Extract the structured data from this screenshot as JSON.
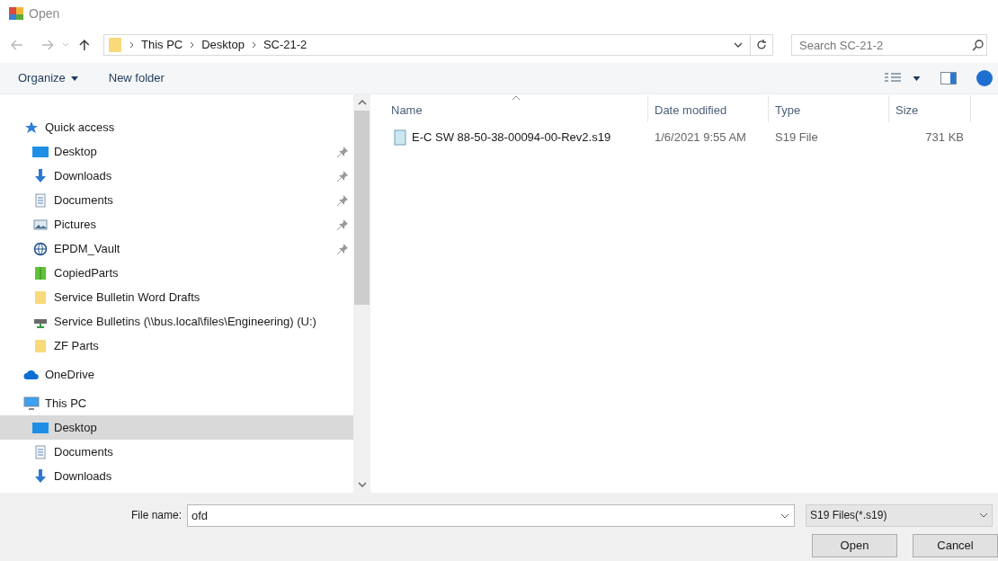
{
  "window": {
    "title": "Open"
  },
  "address": {
    "path": [
      "This PC",
      "Desktop",
      "SC-21-2"
    ]
  },
  "search": {
    "placeholder": "Search SC-21-2"
  },
  "toolbar": {
    "organize": "Organize",
    "new_folder": "New folder"
  },
  "sidebar": {
    "items": [
      {
        "kind": "quick",
        "label": "Quick access",
        "section": true,
        "pinned": false,
        "selected": false
      },
      {
        "kind": "desktop",
        "label": "Desktop",
        "section": false,
        "pinned": true,
        "selected": false
      },
      {
        "kind": "downloads",
        "label": "Downloads",
        "section": false,
        "pinned": true,
        "selected": false
      },
      {
        "kind": "documents",
        "label": "Documents",
        "section": false,
        "pinned": true,
        "selected": false
      },
      {
        "kind": "pictures",
        "label": "Pictures",
        "section": false,
        "pinned": true,
        "selected": false
      },
      {
        "kind": "vault",
        "label": "EPDM_Vault",
        "section": false,
        "pinned": true,
        "selected": false
      },
      {
        "kind": "library",
        "label": "CopiedParts",
        "section": false,
        "pinned": false,
        "selected": false
      },
      {
        "kind": "folder",
        "label": "Service Bulletin Word Drafts",
        "section": false,
        "pinned": false,
        "selected": false
      },
      {
        "kind": "drive",
        "label": "Service Bulletins (\\\\bus.local\\files\\Engineering) (U:)",
        "section": false,
        "pinned": false,
        "selected": false
      },
      {
        "kind": "folder",
        "label": "ZF Parts",
        "section": false,
        "pinned": false,
        "selected": false
      },
      {
        "kind": "cloud",
        "label": "OneDrive",
        "section": true,
        "pinned": false,
        "selected": false
      },
      {
        "kind": "pc",
        "label": "This PC",
        "section": true,
        "pinned": false,
        "selected": false
      },
      {
        "kind": "desktop",
        "label": "Desktop",
        "section": false,
        "pinned": false,
        "selected": true
      },
      {
        "kind": "documents",
        "label": "Documents",
        "section": false,
        "pinned": false,
        "selected": false
      },
      {
        "kind": "downloads",
        "label": "Downloads",
        "section": false,
        "pinned": false,
        "selected": false
      }
    ]
  },
  "table": {
    "columns": [
      "Name",
      "Date modified",
      "Type",
      "Size"
    ],
    "rows": [
      {
        "name": "E-C SW 88-50-38-00094-00-Rev2.s19",
        "date": "1/6/2021 9:55 AM",
        "type": "S19 File",
        "size": "731 KB"
      }
    ]
  },
  "footer": {
    "file_name_label": "File name:",
    "file_name": "ofd",
    "filter": "S19 Files(*.s19)",
    "open": "Open",
    "cancel": "Cancel"
  }
}
